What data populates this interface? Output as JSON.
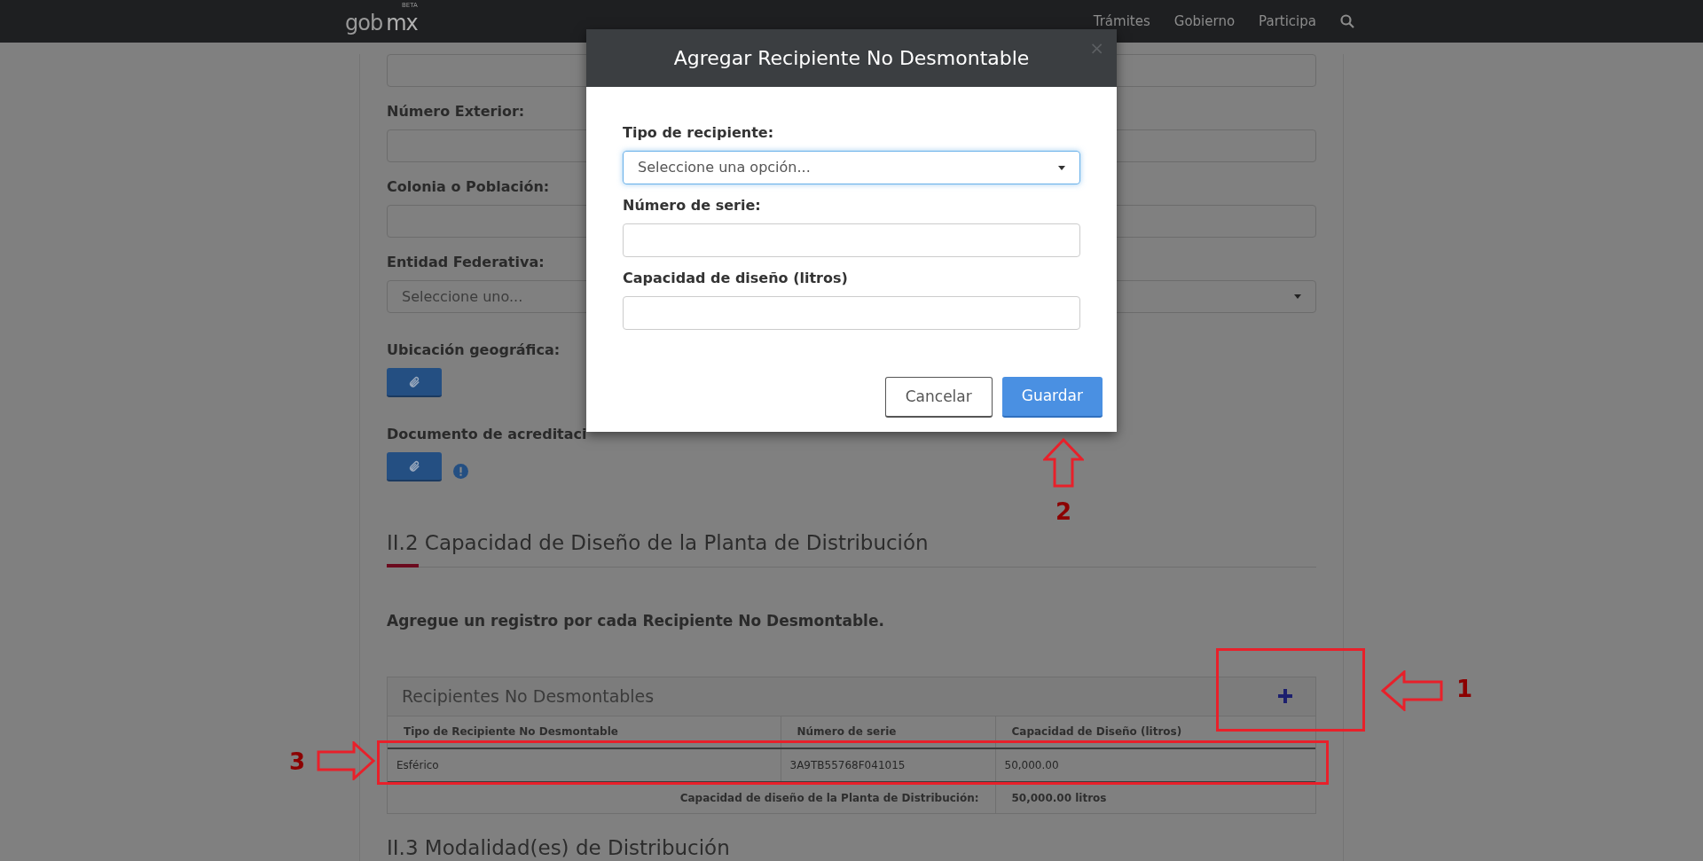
{
  "nav": {
    "logo": "gob",
    "logo_accent": "mx",
    "badge": "BETA",
    "links": [
      "Trámites",
      "Gobierno",
      "Participa"
    ]
  },
  "form": {
    "fields": [
      {
        "kind": "input"
      },
      {
        "label": "Número Exterior:",
        "kind": "input"
      },
      {
        "label": "Colonia o Población:",
        "kind": "input"
      },
      {
        "label": "Entidad Federativa:",
        "kind": "select",
        "placeholder": "Seleccione uno..."
      },
      {
        "label": "Ubicación geográfica:",
        "kind": "attach",
        "alert": false
      },
      {
        "label": "Documento de acreditaci",
        "kind": "attach",
        "alert": true
      }
    ]
  },
  "section_2": {
    "title": "II.2 Capacidad de Diseño de la Planta de Distribución",
    "instruction": "Agregue un registro por cada Recipiente No Desmontable.",
    "panel": {
      "title": "Recipientes No Desmontables",
      "columns": [
        "Tipo de Recipiente No Desmontable",
        "Número de serie",
        "Capacidad de Diseño (litros)"
      ],
      "rows": [
        [
          "Esférico",
          "3A9TB55768F041015",
          "50,000.00"
        ]
      ],
      "total_label": "Capacidad de diseño de la Planta de Distribución:",
      "total_value": "50,000.00 litros"
    }
  },
  "section_3": {
    "title": "II.3 Modalidad(es) de Distribución"
  },
  "modal": {
    "title": "Agregar Recipiente No Desmontable",
    "close": "×",
    "fields": [
      {
        "label": "Tipo de recipiente:",
        "kind": "select",
        "placeholder": "Seleccione una opción...",
        "focused": true
      },
      {
        "label": "Número de serie:",
        "kind": "input",
        "focused": false
      },
      {
        "label": "Capacidad de diseño (litros)",
        "kind": "input",
        "focused": false
      }
    ],
    "buttons": [
      {
        "label": "Cancelar",
        "primary": false
      },
      {
        "label": "Guardar",
        "primary": true
      }
    ]
  },
  "annotations": [
    {
      "number": "1",
      "kind": "left"
    },
    {
      "number": "2",
      "kind": "up"
    },
    {
      "number": "3",
      "kind": "right"
    }
  ]
}
